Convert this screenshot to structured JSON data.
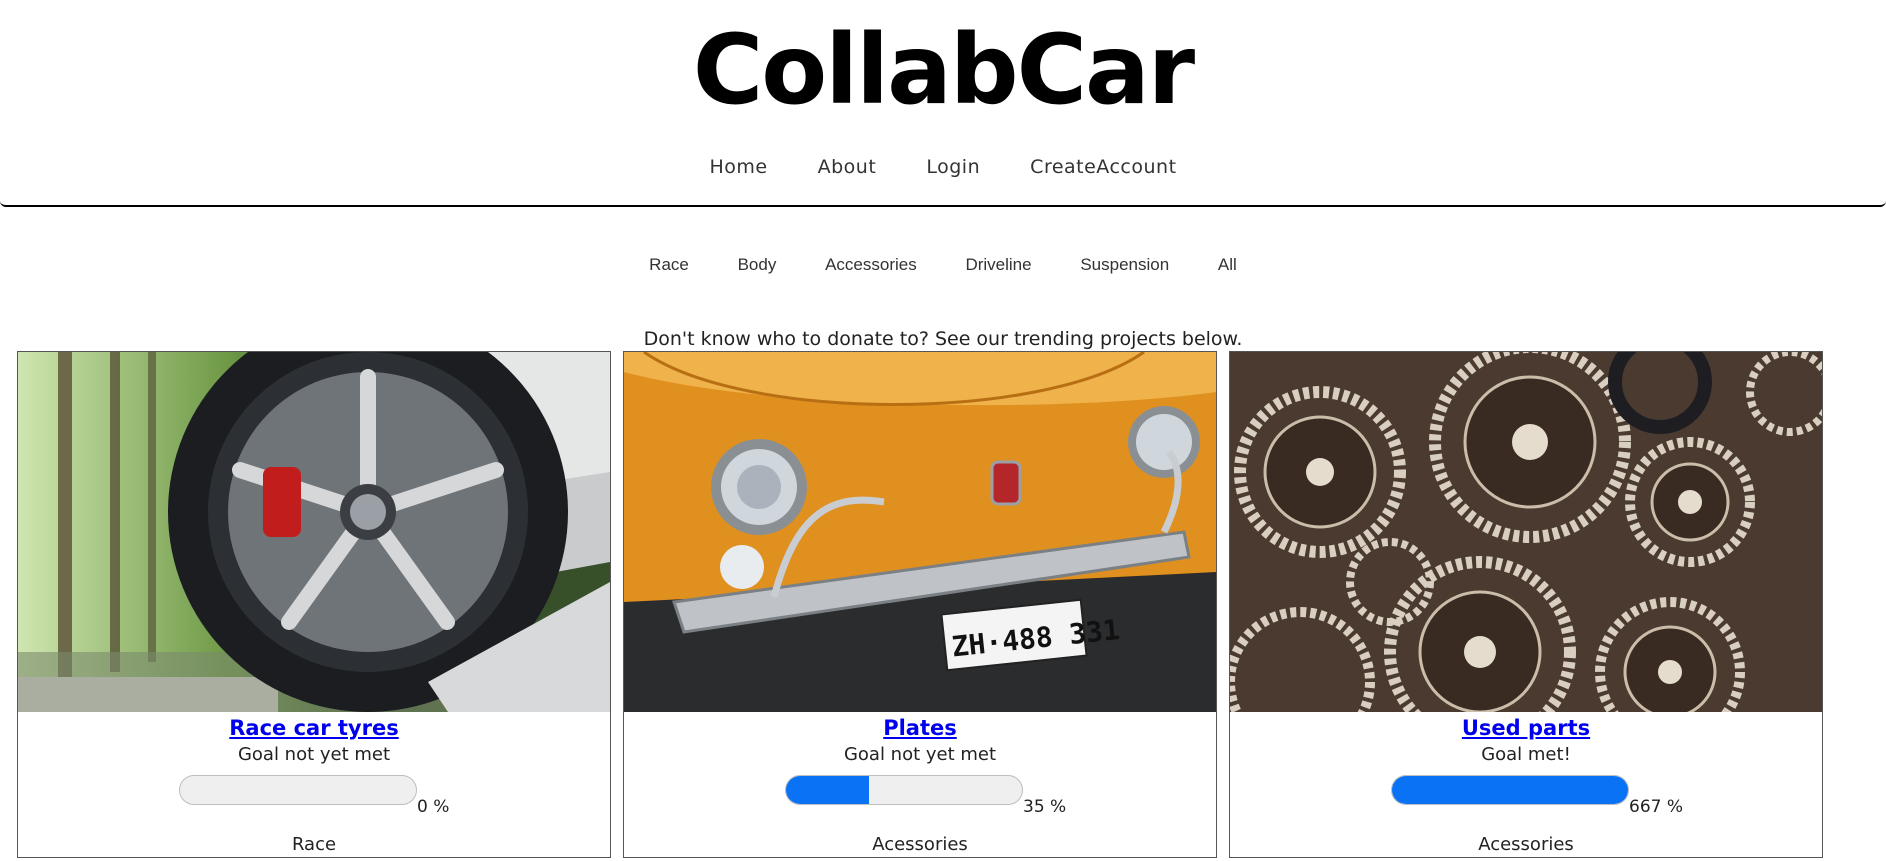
{
  "site": {
    "title": "CollabCar"
  },
  "main_nav": [
    "Home",
    "About",
    "Login",
    "CreateAccount"
  ],
  "category_nav": [
    "Race",
    "Body",
    "Accessories",
    "Driveline",
    "Suspension",
    "All"
  ],
  "intro_text": "Don't know who to donate to? See our trending projects below.",
  "colors": {
    "progress_fill": "#0a72f5",
    "link": "#0000ee"
  },
  "projects": [
    {
      "title": "Race car tyres",
      "status": "Goal not yet met",
      "progress_label": "0 %",
      "progress": 0,
      "category": "Race",
      "image": "car-wheel-photo"
    },
    {
      "title": "Plates",
      "status": "Goal not yet met",
      "progress_label": "35 %",
      "progress": 35,
      "category": "Acessories",
      "image": "orange-car-front-photo"
    },
    {
      "title": "Used parts",
      "status": "Goal met!",
      "progress_label": "667 %",
      "progress": 667,
      "category": "Acessories",
      "image": "gears-photo"
    }
  ]
}
